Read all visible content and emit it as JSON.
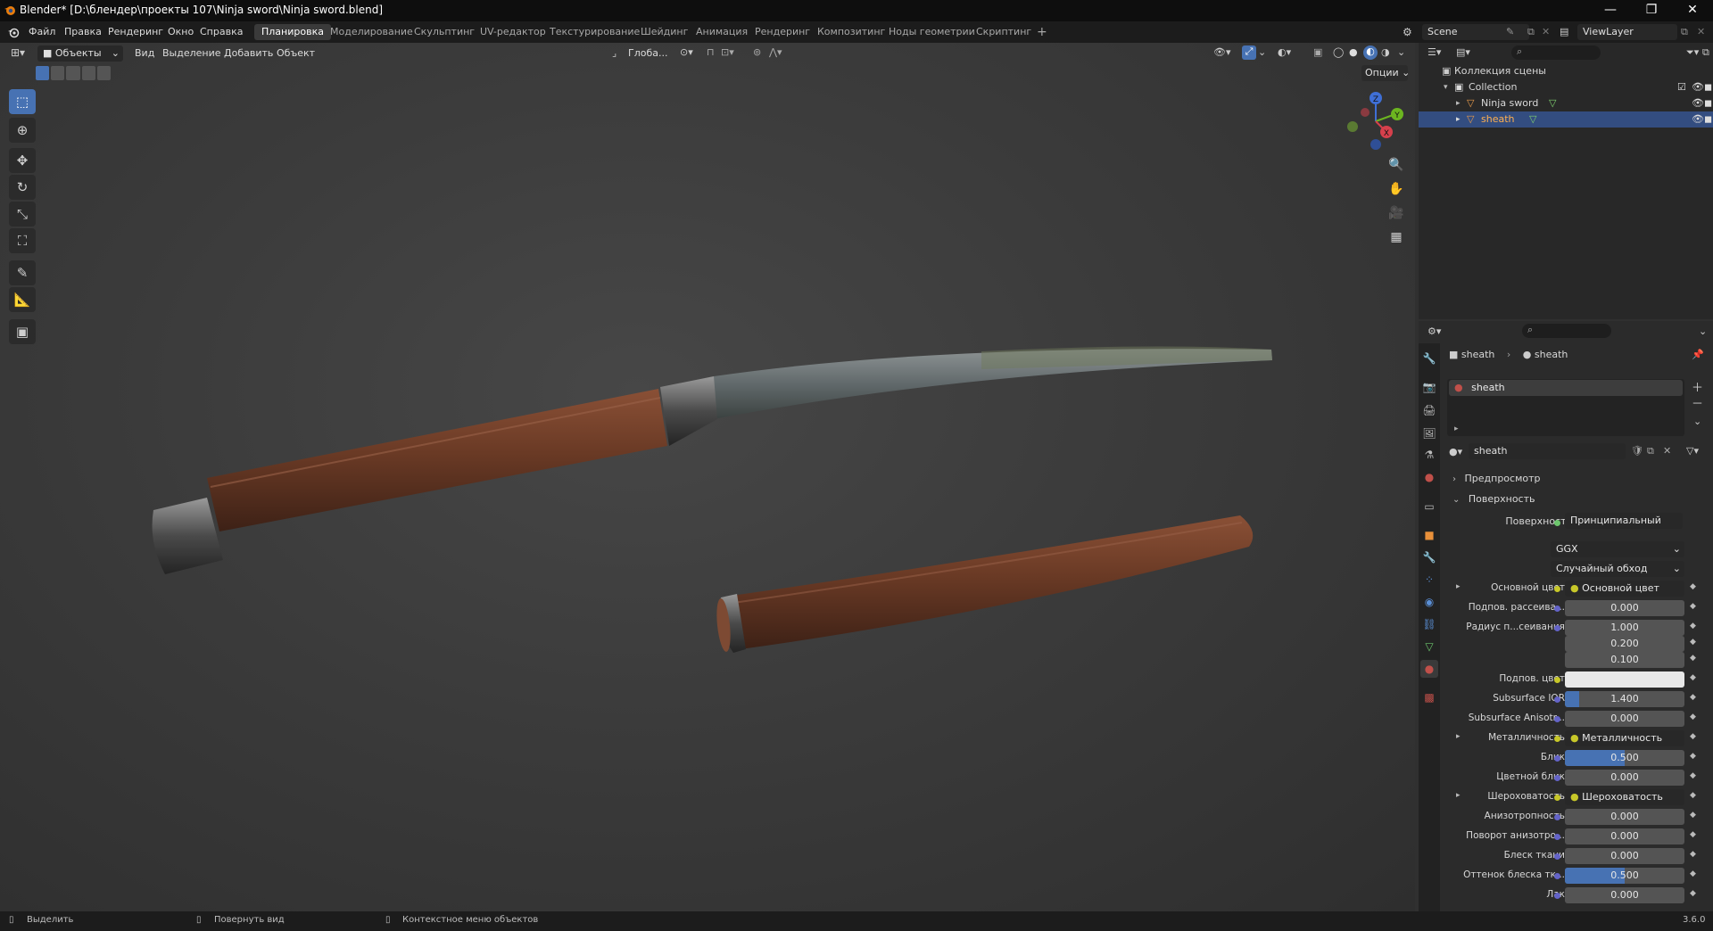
{
  "titlebar": {
    "title": "Blender* [D:\\блендер\\проекты 107\\Ninja sword\\Ninja sword.blend]",
    "minimize": "—",
    "maximize": "❐",
    "close": "✕"
  },
  "menubar": {
    "menus": [
      "Файл",
      "Правка",
      "Рендеринг",
      "Окно",
      "Справка"
    ],
    "workspaces": [
      "Планировка",
      "Моделирование",
      "Скульптинг",
      "UV-редактор",
      "Текстурирование",
      "Шейдинг",
      "Анимация",
      "Рендеринг",
      "Композитинг",
      "Ноды геометрии",
      "Скриптинг"
    ],
    "active_workspace_index": 0,
    "add_tab": "+",
    "scene": "Scene",
    "view_layer": "ViewLayer"
  },
  "viewport_header": {
    "mode": "Объекты",
    "menus": [
      "Вид",
      "Выделение",
      "Добавить",
      "Объект"
    ],
    "transform_orientation": "Глоба...",
    "options": "Опции"
  },
  "gizmo": {
    "x": "X",
    "y": "Y",
    "z": "Z"
  },
  "outliner": {
    "root": "Коллекция сцены",
    "collection": "Collection",
    "objects": [
      {
        "name": "Ninja sword",
        "selected": false
      },
      {
        "name": "sheath",
        "selected": true
      }
    ]
  },
  "properties": {
    "breadcrumb": [
      "sheath",
      "sheath"
    ],
    "material_slot": "sheath",
    "material_name": "sheath",
    "panels": {
      "preview": "Предпросмотр",
      "surface": "Поверхность"
    },
    "surface_label": "Поверхность",
    "surface_value": "Принципиальный BSDF",
    "distribution": "GGX",
    "subsurface_method": "Случайный обход",
    "rows": [
      {
        "label": "Основной цвет",
        "value": "Основной цвет",
        "kind": "link"
      },
      {
        "label": "Подпов. рассеива...",
        "value": "0.000",
        "kind": "num",
        "fill": 0
      },
      {
        "label": "Радиус п...сеивания",
        "value": "1.000",
        "kind": "num",
        "fill": 0
      },
      {
        "label": "",
        "value": "0.200",
        "kind": "num",
        "fill": 0
      },
      {
        "label": "",
        "value": "0.100",
        "kind": "num",
        "fill": 0
      },
      {
        "label": "Подпов. цвет",
        "value": "",
        "kind": "color",
        "color": "#e8e8e8"
      },
      {
        "label": "Subsurface IOR",
        "value": "1.400",
        "kind": "num",
        "fill": 0.12
      },
      {
        "label": "Subsurface Anisotr...",
        "value": "0.000",
        "kind": "num",
        "fill": 0
      },
      {
        "label": "Металличность",
        "value": "Металличность",
        "kind": "link"
      },
      {
        "label": "Блик",
        "value": "0.500",
        "kind": "num",
        "fill": 0.5
      },
      {
        "label": "Цветной блик",
        "value": "0.000",
        "kind": "num",
        "fill": 0
      },
      {
        "label": "Шероховатость",
        "value": "Шероховатость",
        "kind": "link"
      },
      {
        "label": "Анизотропность",
        "value": "0.000",
        "kind": "num",
        "fill": 0
      },
      {
        "label": "Поворот анизотро...",
        "value": "0.000",
        "kind": "num",
        "fill": 0
      },
      {
        "label": "Блеск ткани",
        "value": "0.000",
        "kind": "num",
        "fill": 0
      },
      {
        "label": "Оттенок блеска тк...",
        "value": "0.500",
        "kind": "num",
        "fill": 0.5
      },
      {
        "label": "Лак",
        "value": "0.000",
        "kind": "num",
        "fill": 0
      }
    ]
  },
  "statusbar": {
    "select": "Выделить",
    "rotate": "Повернуть вид",
    "context": "Контекстное меню объектов",
    "version": "3.6.0"
  },
  "colors": {
    "accent": "#4772b3",
    "selection": "#334d80",
    "wood": "#6e3f2a",
    "metal": "#5a5a5a"
  }
}
